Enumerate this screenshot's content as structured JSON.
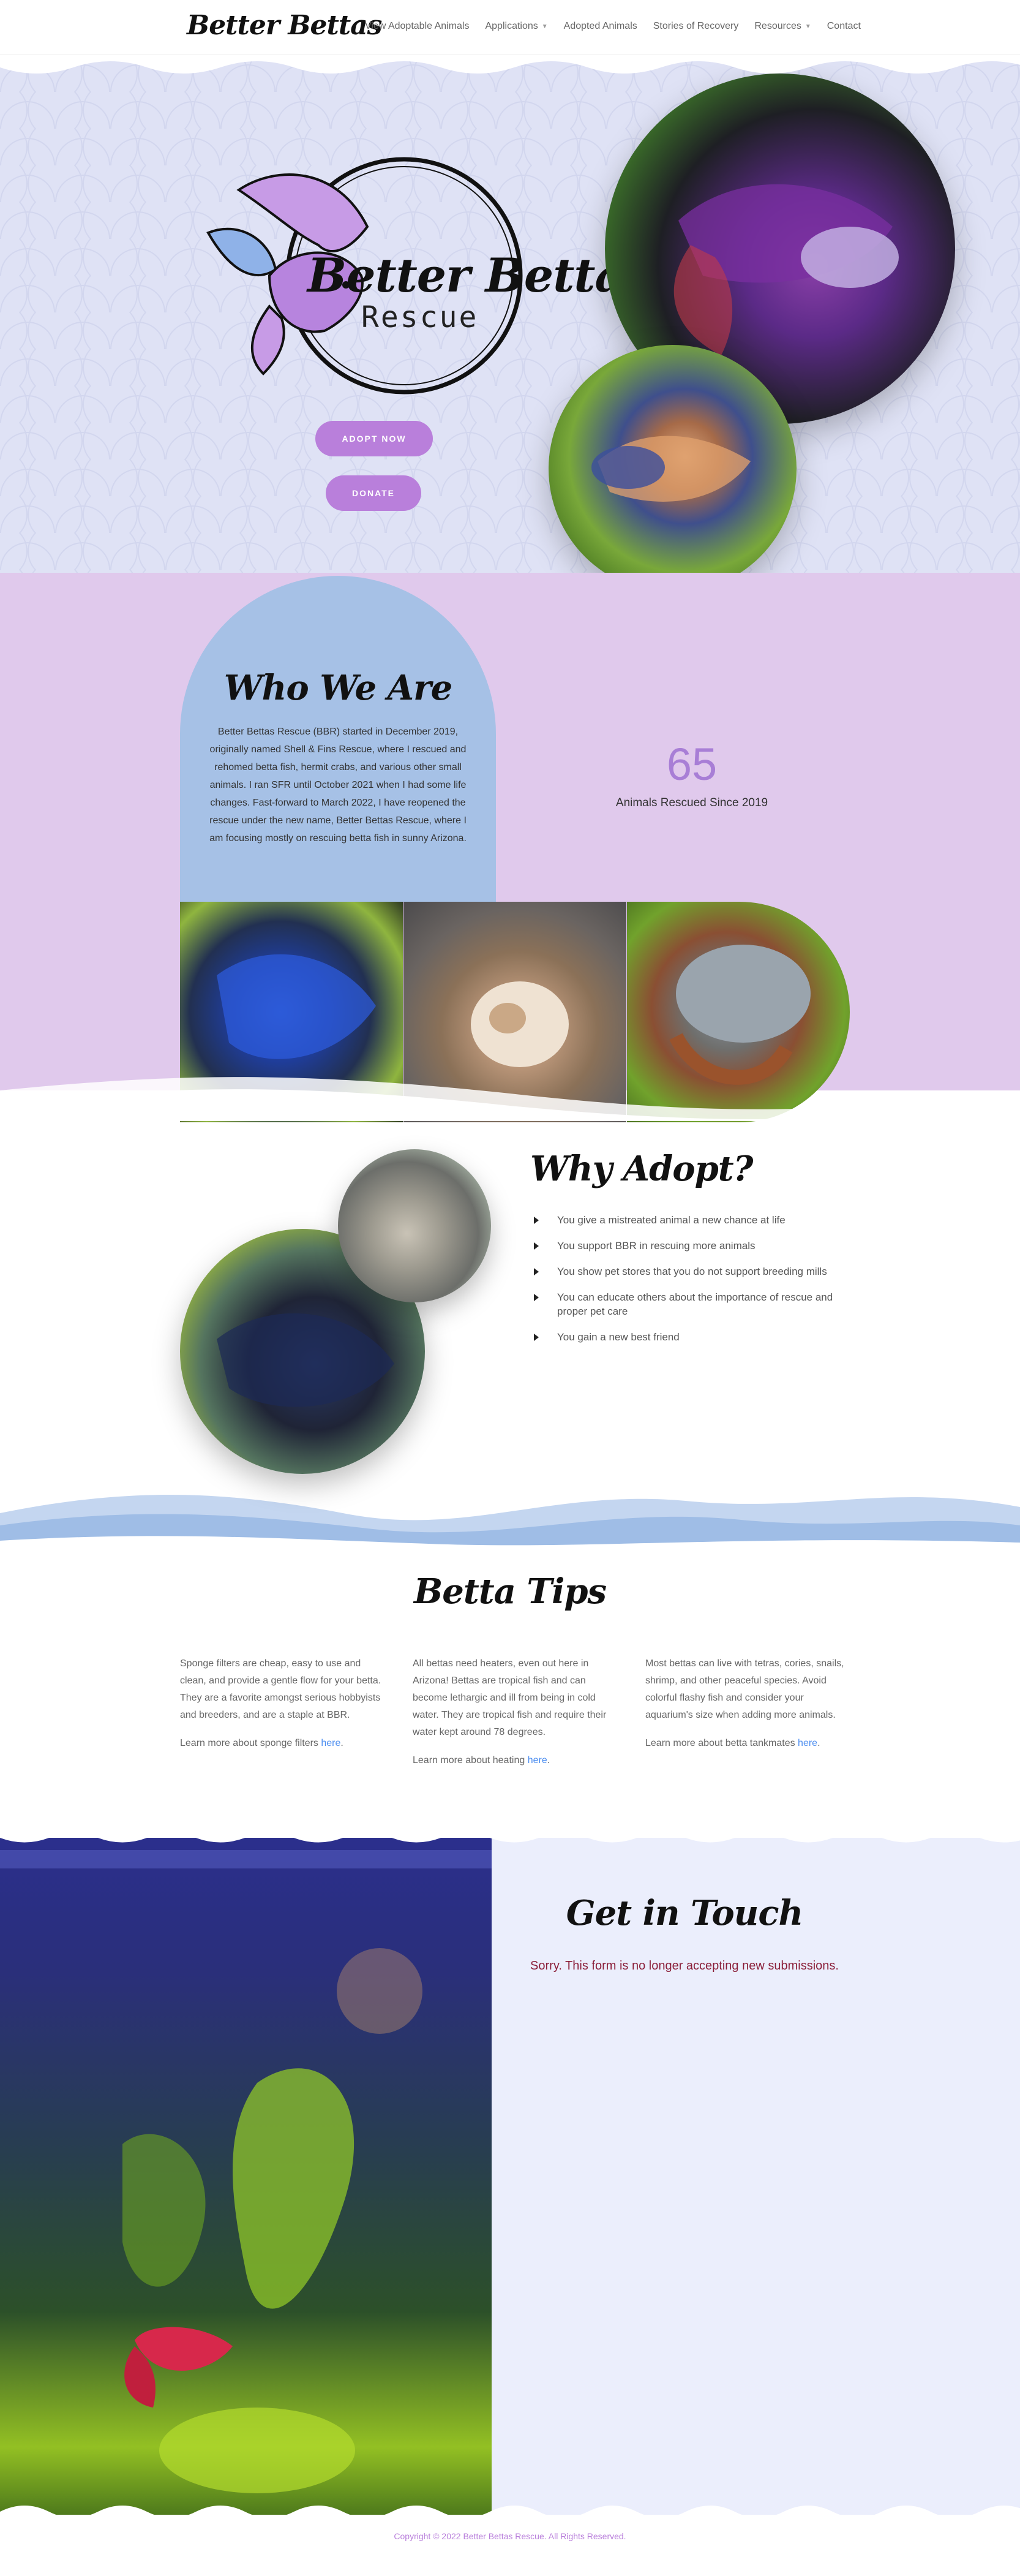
{
  "header": {
    "logo": "Better Bettas",
    "nav": [
      {
        "label": "View Adoptable Animals",
        "has_dropdown": false
      },
      {
        "label": "Applications",
        "has_dropdown": true
      },
      {
        "label": "Adopted Animals",
        "has_dropdown": false
      },
      {
        "label": "Stories of Recovery",
        "has_dropdown": false
      },
      {
        "label": "Resources",
        "has_dropdown": true
      },
      {
        "label": "Contact",
        "has_dropdown": false
      }
    ]
  },
  "hero": {
    "emblem_title": "Better Bettas",
    "emblem_subtitle": "Rescue",
    "adopt_button": "ADOPT NOW",
    "donate_button": "DONATE"
  },
  "who": {
    "title": "Who We Are",
    "text": "Better Bettas Rescue (BBR) started in December 2019, originally named Shell & Fins Rescue, where I rescued and rehomed betta fish, hermit crabs, and various other small animals. I ran SFR until October 2021 when I had some life changes. Fast-forward to March 2022, I have reopened the rescue under the new name, Better Bettas Rescue, where I am focusing mostly on rescuing betta fish in sunny Arizona.",
    "stat_number": "65",
    "stat_label": "Animals Rescued Since 2019"
  },
  "why": {
    "title": "Why Adopt?",
    "items": [
      "You give a mistreated animal a new chance at life",
      "You support BBR in rescuing more animals",
      "You show pet stores that you do not support breeding mills",
      "You can educate others about the importance of rescue and proper pet care",
      "You gain a new best friend"
    ]
  },
  "tips": {
    "title": "Betta Tips",
    "columns": [
      {
        "text": "Sponge filters are cheap, easy to use and clean, and provide a gentle flow for your betta. They are a favorite amongst serious hobbyists and breeders, and are a staple at BBR.",
        "link_prefix": "Learn more about sponge filters ",
        "link_text": "here",
        "link_suffix": "."
      },
      {
        "text": "All bettas need heaters, even out here in Arizona! Bettas are tropical fish and can become lethargic and ill from being in cold water. They are tropical fish and require their water kept around 78 degrees.",
        "link_prefix": "Learn more about heating ",
        "link_text": "here",
        "link_suffix": "."
      },
      {
        "text": "Most bettas can live with tetras, cories, snails, shrimp, and other peaceful species. Avoid colorful flashy fish and consider your aquarium's size when adding more animals.",
        "link_prefix": "Learn more about betta tankmates ",
        "link_text": "here",
        "link_suffix": "."
      }
    ]
  },
  "contact": {
    "title": "Get in Touch",
    "message": "Sorry. This form is no longer accepting new submissions."
  },
  "footer": {
    "copyright": "Copyright © 2022 Better Bettas Rescue. All Rights Reserved."
  },
  "colors": {
    "accent_purple": "#b97fdb",
    "hero_bg": "#dfe2f5",
    "section_purple": "#e0c9ec",
    "arch_blue": "#a6c1e6",
    "link_blue": "#4d8ef0",
    "error_red": "#8b1f3a"
  }
}
